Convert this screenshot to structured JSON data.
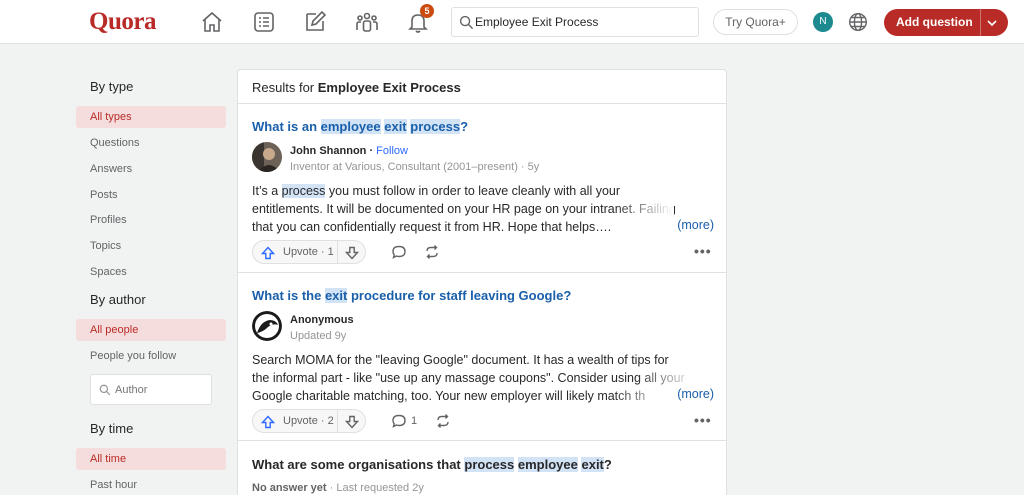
{
  "header": {
    "logo": "Quora",
    "notification_count": "5",
    "search_value": "Employee Exit Process",
    "try_label": "Try Quora+",
    "avatar_initial": "N",
    "add_question_label": "Add question"
  },
  "sidebar": {
    "by_type": {
      "heading": "By type",
      "items": [
        "All types",
        "Questions",
        "Answers",
        "Posts",
        "Profiles",
        "Topics",
        "Spaces"
      ]
    },
    "by_author": {
      "heading": "By author",
      "items": [
        "All people",
        "People you follow"
      ],
      "author_placeholder": "Author"
    },
    "by_time": {
      "heading": "By time",
      "items": [
        "All time",
        "Past hour"
      ]
    }
  },
  "results": {
    "prefix": "Results for ",
    "query": "Employee Exit Process",
    "items": [
      {
        "title_parts": [
          "What is an ",
          "employee",
          " ",
          "exit",
          " ",
          "process",
          "?"
        ],
        "author": "John Shannon",
        "follow": "Follow",
        "meta": "Inventor at Various, Consultant (2001–present) · 5y",
        "body_lines": [
          [
            "It’s a ",
            "process",
            " you must follow in order to leave cleanly with all your"
          ],
          [
            "entitlements. It will be documented on your HR page on your intranet. Failing"
          ],
          [
            "that you can confidentially request it from HR. Hope that helps…."
          ]
        ],
        "more": "(more)",
        "upvote": "Upvote · 1",
        "comments": "",
        "dots": "•••"
      },
      {
        "title_parts": [
          "What is the ",
          "exit",
          " procedure for staff leaving Google?"
        ],
        "author": "Anonymous",
        "meta": "Updated 9y",
        "body_lines": [
          [
            "Search MOMA for the \"leaving Google\" document. It has a wealth of tips for"
          ],
          [
            "the informal part - like \"use up any massage coupons\". Consider using all your"
          ],
          [
            "Google charitable matching, too. Your new employer will likely match th"
          ]
        ],
        "more": "(more)",
        "upvote": "Upvote · 2",
        "comments": "1",
        "dots": "•••"
      },
      {
        "title_parts": [
          "What are some organisations that ",
          "process",
          " ",
          "employee",
          " ",
          "exit",
          "?"
        ],
        "no_answer": "No answer yet",
        "requested": " · Last requested 2y"
      }
    ]
  },
  "colors": {
    "brand": "#b92b27",
    "link": "#195faa",
    "highlight": "#d3e3f6",
    "active_bg": "#f5dddd"
  }
}
